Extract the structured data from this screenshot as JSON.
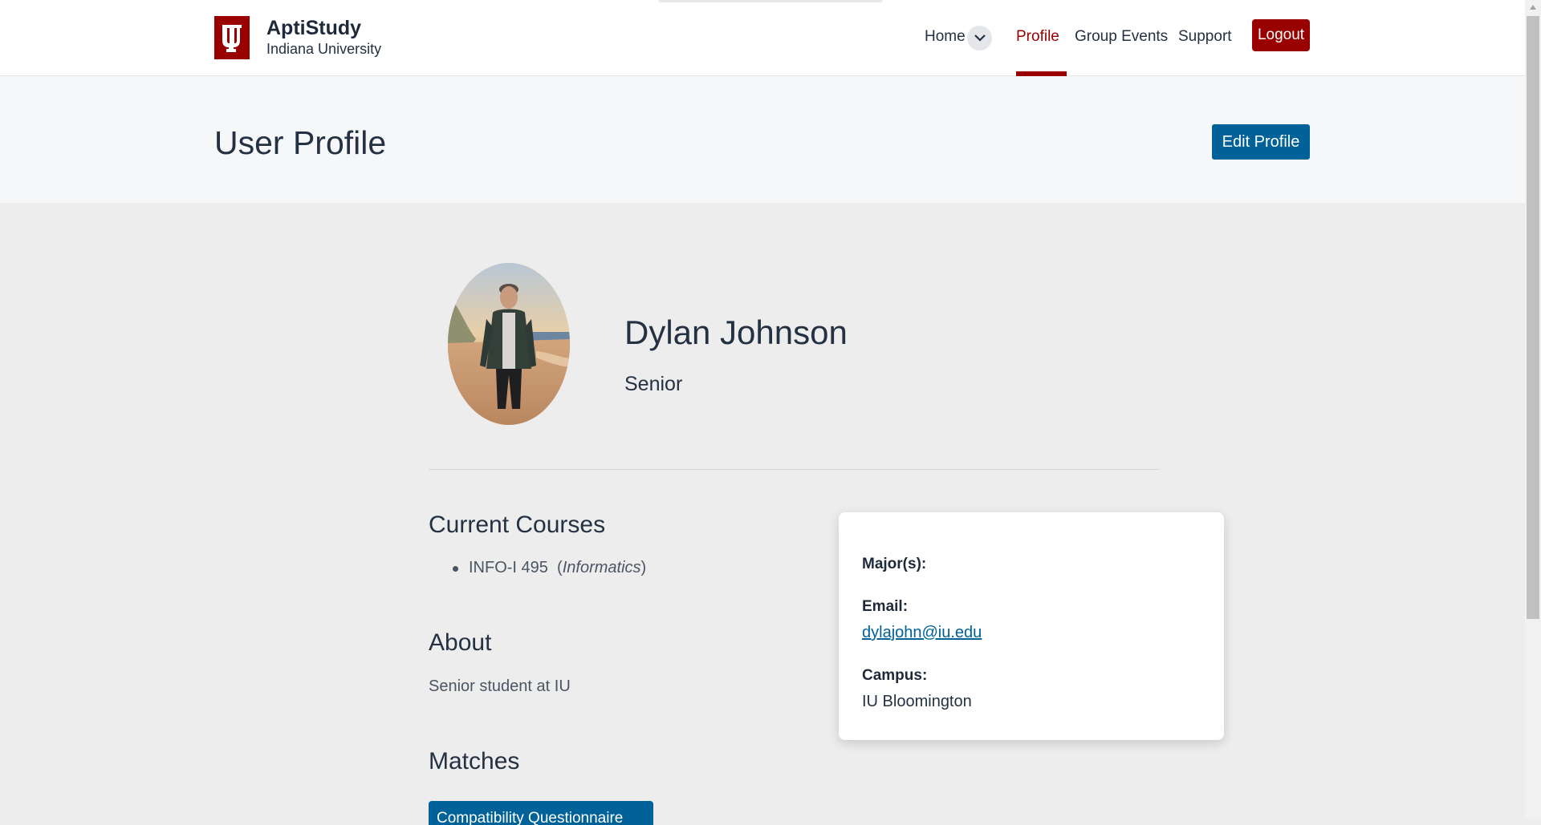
{
  "header": {
    "brand_title": "AptiStudy",
    "brand_subtitle": "Indiana University",
    "nav": {
      "home": "Home",
      "profile": "Profile",
      "group_events": "Group Events",
      "support": "Support"
    },
    "logout_label": "Logout"
  },
  "page": {
    "title": "User Profile",
    "edit_label": "Edit Profile"
  },
  "profile": {
    "name": "Dylan Johnson",
    "year": "Senior",
    "sections": {
      "courses_title": "Current Courses",
      "about_title": "About",
      "matches_title": "Matches"
    },
    "courses": [
      {
        "code": "INFO-I 495",
        "dept": "Informatics"
      }
    ],
    "about": "Senior student at IU",
    "matches_button": "Compatibility Questionnaire",
    "card": {
      "major_label": "Major(s):",
      "major_value": "",
      "email_label": "Email:",
      "email": "dylajohn@iu.edu",
      "campus_label": "Campus:",
      "campus": "IU Bloomington"
    }
  },
  "colors": {
    "iu_crimson": "#990000",
    "action_blue": "#006298",
    "page_background": "#eeeded"
  },
  "icons": {
    "logo": "iu-trident-logo",
    "home_toggle": "chevron-down-icon"
  }
}
